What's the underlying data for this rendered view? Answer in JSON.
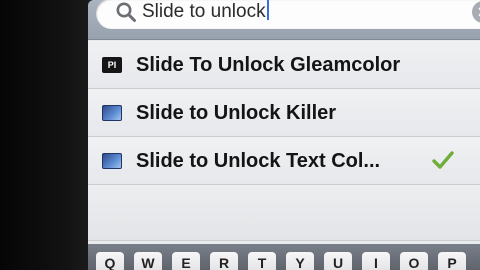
{
  "search": {
    "query": "Slide to unlock"
  },
  "results": [
    {
      "label": "Slide To Unlock Gleamcolor",
      "icon": "gleamcolor-app-icon",
      "icon_text": "PI",
      "checked": false
    },
    {
      "label": "Slide to Unlock Killer",
      "icon": "app-icon",
      "checked": false
    },
    {
      "label": "Slide to Unlock Text Col...",
      "icon": "app-icon",
      "checked": true
    }
  ],
  "keyboard": {
    "keys": [
      "Q",
      "W",
      "E",
      "R",
      "T",
      "Y",
      "U",
      "I",
      "O",
      "P"
    ]
  },
  "colors": {
    "check": "#6fae3a",
    "caret": "#3a6fd8"
  }
}
